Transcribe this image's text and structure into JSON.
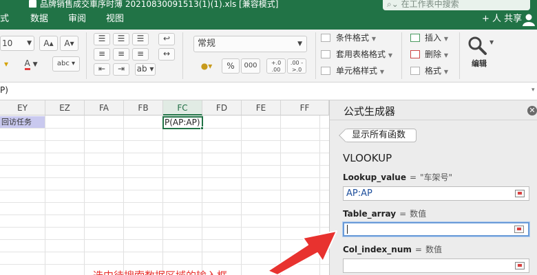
{
  "window": {
    "title": "品牌销售成交車序时薄 20210830091513(1)(1).xls  [兼容模式]",
    "search_placeholder": "在工作表中搜索",
    "share_label": "共享"
  },
  "tabs": [
    {
      "label": "式"
    },
    {
      "label": "数据"
    },
    {
      "label": "审阅"
    },
    {
      "label": "视图"
    }
  ],
  "ribbon": {
    "font_size": "10",
    "number_format": "常规",
    "conditional_format": "条件格式",
    "table_format": "套用表格格式",
    "cell_style": "单元格样式",
    "insert": "插入",
    "delete": "删除",
    "format": "格式",
    "edit": "编辑",
    "percent": "%",
    "thousands": "000",
    "inc_decimal": "+.0 .00",
    "dec_decimal": ".00 ->.0"
  },
  "formula_bar": {
    "text": "P)"
  },
  "grid": {
    "columns": [
      "EY",
      "EZ",
      "FA",
      "FB",
      "FC",
      "FD",
      "FE",
      "FF"
    ],
    "selected_column": "FC",
    "ey_cell": "回访任务",
    "active_cell_text": "P(AP:AP)",
    "annotation": "选中待搜索数据区域的输入框"
  },
  "formula_builder": {
    "title": "公式生成器",
    "show_all_button": "显示所有函数",
    "function_name": "VLOOKUP",
    "args": [
      {
        "name": "Lookup_value",
        "result": "\"车架号\"",
        "input": "AP:AP"
      },
      {
        "name": "Table_array",
        "result": "数值",
        "input": ""
      },
      {
        "name": "Col_index_num",
        "result": "数值",
        "input": ""
      }
    ]
  },
  "colors": {
    "accent": "#217346",
    "annotation": "#e8322f",
    "highlight_cell": "#c9c9ef"
  }
}
